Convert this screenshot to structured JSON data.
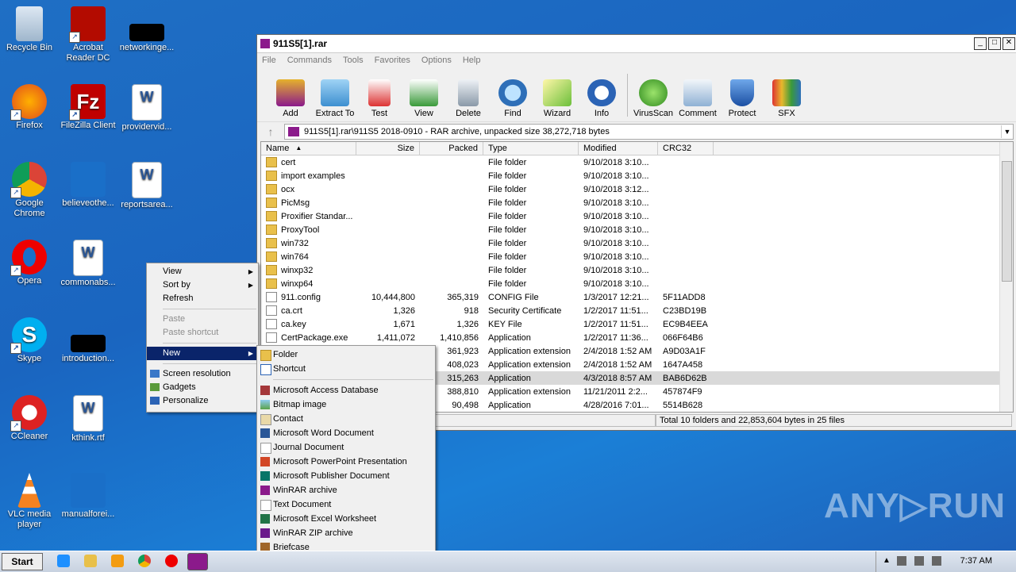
{
  "desktop": {
    "icons": [
      {
        "label": "Recycle Bin"
      },
      {
        "label": "Acrobat Reader DC"
      },
      {
        "label": "networkinge..."
      },
      {
        "label": "Firefox"
      },
      {
        "label": "FileZilla Client"
      },
      {
        "label": "providervid..."
      },
      {
        "label": "Google Chrome"
      },
      {
        "label": "believeothe..."
      },
      {
        "label": "reportsarea..."
      },
      {
        "label": "Opera"
      },
      {
        "label": "commonabs..."
      },
      {
        "label": "Skype"
      },
      {
        "label": "introduction..."
      },
      {
        "label": "CCleaner"
      },
      {
        "label": "kthink.rtf"
      },
      {
        "label": "VLC media player"
      },
      {
        "label": "manualforei..."
      }
    ],
    "watermark": "ANY▷RUN"
  },
  "window": {
    "title": "911S5[1].rar",
    "menu": [
      "File",
      "Commands",
      "Tools",
      "Favorites",
      "Options",
      "Help"
    ],
    "toolbar": [
      "Add",
      "Extract To",
      "Test",
      "View",
      "Delete",
      "Find",
      "Wizard",
      "Info",
      "VirusScan",
      "Comment",
      "Protect",
      "SFX"
    ],
    "address": "911S5[1].rar\\911S5 2018-0910 - RAR archive, unpacked size 38,272,718 bytes",
    "columns": [
      "Name",
      "Size",
      "Packed",
      "Type",
      "Modified",
      "CRC32"
    ],
    "rows": [
      {
        "name": "cert",
        "size": "",
        "packed": "",
        "type": "File folder",
        "modified": "9/10/2018 3:10...",
        "crc": ""
      },
      {
        "name": "import examples",
        "size": "",
        "packed": "",
        "type": "File folder",
        "modified": "9/10/2018 3:10...",
        "crc": ""
      },
      {
        "name": "ocx",
        "size": "",
        "packed": "",
        "type": "File folder",
        "modified": "9/10/2018 3:12...",
        "crc": ""
      },
      {
        "name": "PicMsg",
        "size": "",
        "packed": "",
        "type": "File folder",
        "modified": "9/10/2018 3:10...",
        "crc": ""
      },
      {
        "name": "Proxifier Standar...",
        "size": "",
        "packed": "",
        "type": "File folder",
        "modified": "9/10/2018 3:10...",
        "crc": ""
      },
      {
        "name": "ProxyTool",
        "size": "",
        "packed": "",
        "type": "File folder",
        "modified": "9/10/2018 3:10...",
        "crc": ""
      },
      {
        "name": "win732",
        "size": "",
        "packed": "",
        "type": "File folder",
        "modified": "9/10/2018 3:10...",
        "crc": ""
      },
      {
        "name": "win764",
        "size": "",
        "packed": "",
        "type": "File folder",
        "modified": "9/10/2018 3:10...",
        "crc": ""
      },
      {
        "name": "winxp32",
        "size": "",
        "packed": "",
        "type": "File folder",
        "modified": "9/10/2018 3:10...",
        "crc": ""
      },
      {
        "name": "winxp64",
        "size": "",
        "packed": "",
        "type": "File folder",
        "modified": "9/10/2018 3:10...",
        "crc": ""
      },
      {
        "name": "911.config",
        "size": "10,444,800",
        "packed": "365,319",
        "type": "CONFIG File",
        "modified": "1/3/2017 12:21...",
        "crc": "5F11ADD8"
      },
      {
        "name": "ca.crt",
        "size": "1,326",
        "packed": "918",
        "type": "Security Certificate",
        "modified": "1/2/2017 11:51...",
        "crc": "C23BD19B"
      },
      {
        "name": "ca.key",
        "size": "1,671",
        "packed": "1,326",
        "type": "KEY File",
        "modified": "1/2/2017 11:51...",
        "crc": "EC9B4EEA"
      },
      {
        "name": "CertPackage.exe",
        "size": "1,411,072",
        "packed": "1,410,856",
        "type": "Application",
        "modified": "1/2/2017 11:36...",
        "crc": "066F64B6"
      },
      {
        "name": "",
        "size": "",
        "packed": "361,923",
        "type": "Application extension",
        "modified": "2/4/2018 1:52 AM",
        "crc": "A9D03A1F"
      },
      {
        "name": "",
        "size": "",
        "packed": "408,023",
        "type": "Application extension",
        "modified": "2/4/2018 1:52 AM",
        "crc": "1647A458"
      },
      {
        "name": "",
        "size": "",
        "packed": "315,263",
        "type": "Application",
        "modified": "4/3/2018 8:57 AM",
        "crc": "BAB6D62B"
      },
      {
        "name": "",
        "size": "",
        "packed": "388,810",
        "type": "Application extension",
        "modified": "11/21/2011 2:2...",
        "crc": "457874F9"
      },
      {
        "name": "",
        "size": "",
        "packed": "90,498",
        "type": "Application",
        "modified": "4/28/2016 7:01...",
        "crc": "5514B628"
      }
    ],
    "status": "Total 10 folders and 22,853,604 bytes in 25 files"
  },
  "context_menu": {
    "items": [
      "View",
      "Sort by",
      "Refresh",
      "Paste",
      "Paste shortcut",
      "New",
      "Screen resolution",
      "Gadgets",
      "Personalize"
    ]
  },
  "new_submenu": {
    "items": [
      "Folder",
      "Shortcut",
      "Microsoft Access Database",
      "Bitmap image",
      "Contact",
      "Microsoft Word Document",
      "Journal Document",
      "Microsoft PowerPoint Presentation",
      "Microsoft Publisher Document",
      "WinRAR archive",
      "Text Document",
      "Microsoft Excel Worksheet",
      "WinRAR ZIP archive",
      "Briefcase"
    ]
  },
  "taskbar": {
    "start": "Start",
    "clock": "7:37 AM"
  }
}
